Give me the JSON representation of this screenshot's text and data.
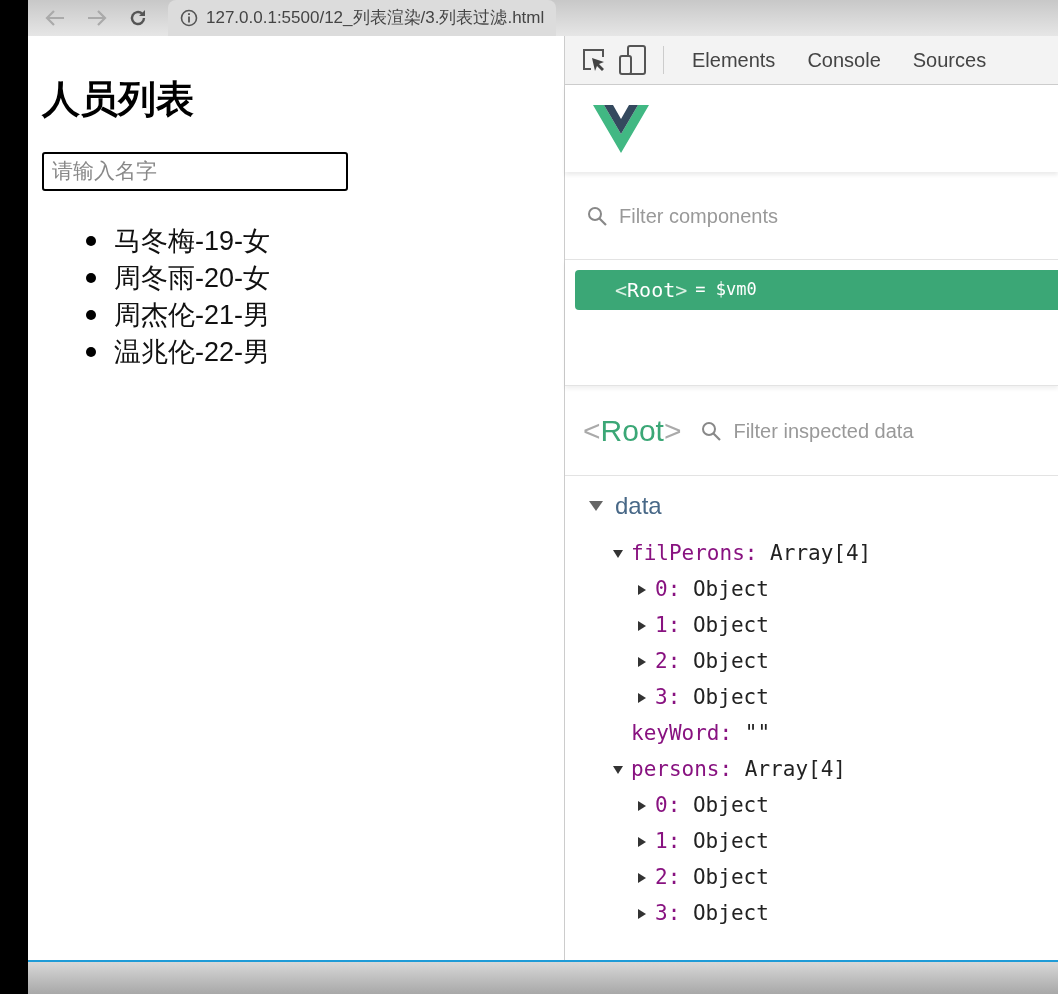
{
  "browser": {
    "url": "127.0.0.1:5500/12_列表渲染/3.列表过滤.html"
  },
  "page": {
    "title": "人员列表",
    "search": {
      "placeholder": "请输入名字"
    },
    "persons": [
      "马冬梅-19-女",
      "周冬雨-20-女",
      "周杰伦-21-男",
      "温兆伦-22-男"
    ]
  },
  "devtools": {
    "tabs": [
      {
        "label": "Elements",
        "selected": false
      },
      {
        "label": "Console",
        "selected": false
      },
      {
        "label": "Sources",
        "selected": false
      }
    ],
    "component_filter": {
      "placeholder": "Filter components"
    },
    "components": [
      {
        "open": "<",
        "name": "Root",
        "close": ">",
        "ref": "= $vm0",
        "selected": true
      }
    ],
    "inspector": {
      "open": "<",
      "name": "Root",
      "close": ">",
      "filter": {
        "placeholder": "Filter inspected data"
      },
      "sections": [
        {
          "label": "data",
          "expanded": true,
          "children": [
            {
              "kind": "object",
              "key": "filPerons:",
              "value": "Array[4]",
              "expanded": true,
              "children": [
                {
                  "kind": "object",
                  "key": "0:",
                  "value": "Object",
                  "expanded": false
                },
                {
                  "kind": "object",
                  "key": "1:",
                  "value": "Object",
                  "expanded": false
                },
                {
                  "kind": "object",
                  "key": "2:",
                  "value": "Object",
                  "expanded": false
                },
                {
                  "kind": "object",
                  "key": "3:",
                  "value": "Object",
                  "expanded": false
                }
              ]
            },
            {
              "kind": "primitive",
              "key": "keyWord:",
              "value": "\"\""
            },
            {
              "kind": "object",
              "key": "persons:",
              "value": "Array[4]",
              "expanded": true,
              "children": [
                {
                  "kind": "object",
                  "key": "0:",
                  "value": "Object",
                  "expanded": false
                },
                {
                  "kind": "object",
                  "key": "1:",
                  "value": "Object",
                  "expanded": false
                },
                {
                  "kind": "object",
                  "key": "2:",
                  "value": "Object",
                  "expanded": false
                },
                {
                  "kind": "object",
                  "key": "3:",
                  "value": "Object",
                  "expanded": false
                }
              ]
            }
          ]
        }
      ]
    }
  }
}
